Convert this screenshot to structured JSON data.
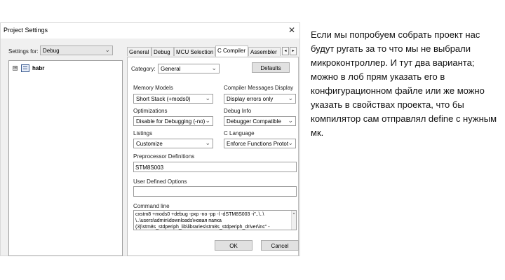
{
  "window": {
    "title": "Project Settings",
    "close_glyph": "✕"
  },
  "settings_for": {
    "label": "Settings for:",
    "value": "Debug"
  },
  "tree": {
    "expander": "⊞",
    "root": "habr"
  },
  "tabs": [
    "General",
    "Debug",
    "MCU Selection",
    "C Compiler",
    "Assembler"
  ],
  "tab_scroll": {
    "left": "◂",
    "right": "▸"
  },
  "category": {
    "label": "Category:",
    "value": "General",
    "defaults_button": "Defaults"
  },
  "fields": {
    "memory_models": {
      "label": "Memory Models",
      "value": "Short Stack (+mods0)"
    },
    "compiler_messages": {
      "label": "Compiler Messages Display",
      "value": "Display errors only"
    },
    "optimizations": {
      "label": "Optimizations",
      "value": "Disable for Debugging (-no)"
    },
    "debug_info": {
      "label": "Debug Info",
      "value": "Debugger Compatible"
    },
    "listings": {
      "label": "Listings",
      "value": "Customize"
    },
    "c_language": {
      "label": "C Language",
      "value": "Enforce Functions Protot"
    },
    "preprocessor": {
      "label": "Preprocessor Definitions",
      "value": "STM8S003"
    },
    "user_options": {
      "label": "User Defined Options",
      "value": ""
    },
    "command_line": {
      "label": "Command line",
      "lines": [
        "cxstm8 +mods0 +debug -pxp -no -pp -l -dSTM8S003 -i\"..\\..\\",
        "\\..\\users\\admin\\downloads\\новая папка",
        "(3)\\stm8s_stdperiph_lib\\libraries\\stm8s_stdperiph_driver\\inc\" -"
      ]
    }
  },
  "buttons": {
    "ok": "OK",
    "cancel": "Cancel"
  },
  "note_text": "Если мы попробуем собрать проект нас будут ругать за то что мы не выбрали микроконтроллер. И тут два варианта; можно в лоб прям указать его в конфигурационном файле или же можно указать в свойствах проекта, что бы компилятор сам отправлял define с нужным мк."
}
